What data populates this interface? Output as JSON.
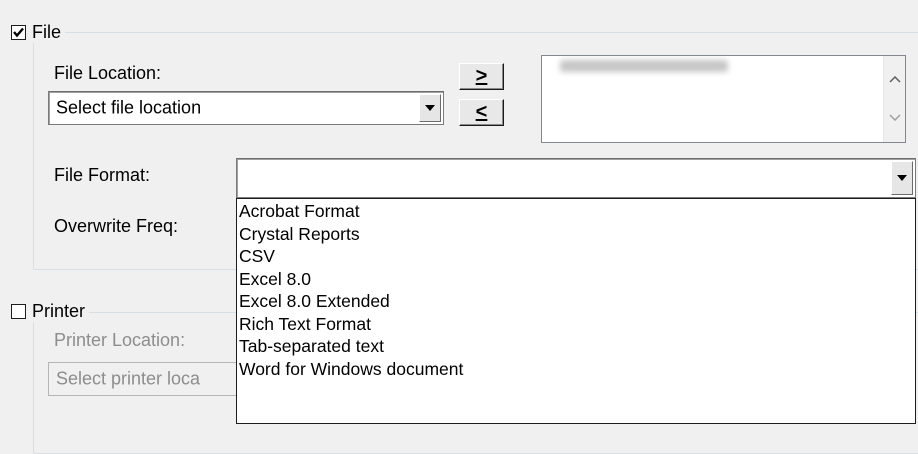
{
  "file_group": {
    "label": "File",
    "checked": true,
    "file_location_label": "File Location:",
    "file_location_value": "Select file location",
    "add_button": ">",
    "remove_button": "<",
    "file_format_label": "File Format:",
    "file_format_value": "",
    "overwrite_freq_label": "Overwrite Freq:"
  },
  "format_options": [
    "Acrobat Format",
    "Crystal Reports",
    "CSV",
    "Excel 8.0",
    "Excel 8.0 Extended",
    "Rich Text Format",
    "Tab-separated text",
    "Word for Windows document"
  ],
  "printer_group": {
    "label": "Printer",
    "checked": false,
    "printer_location_label": "Printer Location:",
    "printer_location_value": "Select printer loca"
  }
}
